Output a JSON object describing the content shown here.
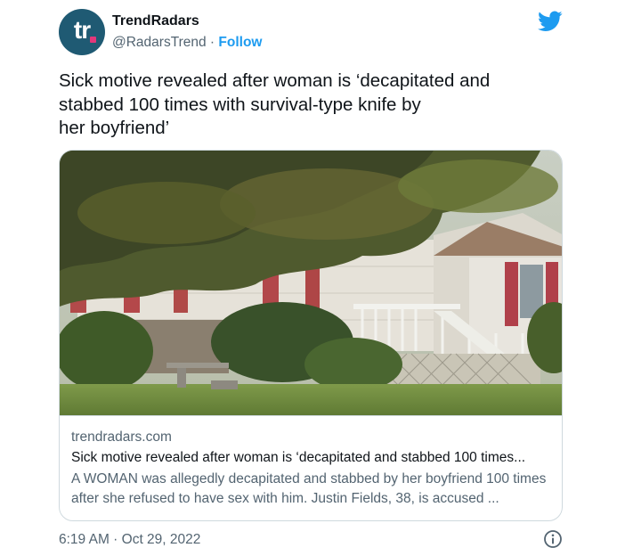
{
  "account": {
    "avatar_text": "tr",
    "name": "TrendRadars",
    "handle": "@RadarsTrend",
    "separator": " · ",
    "follow_label": "Follow"
  },
  "tweet": {
    "text": "Sick motive revealed after woman is ‘decapitated and\nstabbed 100 times with survival-type knife by\nher boyfriend’"
  },
  "card": {
    "domain": "trendradars.com",
    "title": "Sick motive revealed after woman is ‘decapitated and stabbed 100 times...",
    "description": "A WOMAN was allegedly decapitated and stabbed by her boyfriend 100 times after she refused to have sex with him. Justin Fields, 38, is accused ..."
  },
  "meta": {
    "timestamp": "6:19 AM · Oct 29, 2022"
  },
  "icons": {
    "brand": "twitter-bird-icon",
    "info": "info-icon"
  },
  "colors": {
    "accent": "#1d9bf0",
    "avatar_bg": "#1f5a73",
    "avatar_dot": "#e3377b",
    "secondary_text": "#536471",
    "border": "#cfd9de"
  }
}
